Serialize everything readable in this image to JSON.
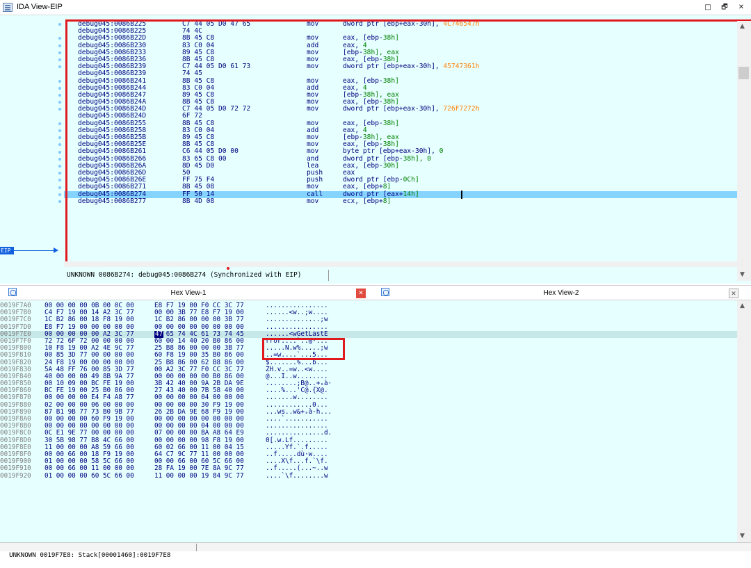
{
  "window": {
    "title": "IDA View-EIP",
    "controls": [
      "□",
      "🗗",
      "✕"
    ]
  },
  "ida": {
    "rows": [
      {
        "addr": "debug045:0086B225",
        "bytes": "C7 44 05 D0 47 65",
        "mnem": "mov",
        "ops": "dword ptr [ebp+eax-30h], ",
        "num": "",
        "imm": "4C746547h"
      },
      {
        "addr": "debug045:0086B225",
        "bytes": "74 4C",
        "mnem": "",
        "ops": "",
        "num": "",
        "imm": ""
      },
      {
        "addr": "debug045:0086B22D",
        "bytes": "8B 45 C8",
        "mnem": "mov",
        "ops": "eax, [ebp-",
        "num": "38h]",
        "imm": ""
      },
      {
        "addr": "debug045:0086B230",
        "bytes": "83 C0 04",
        "mnem": "add",
        "ops": "eax, ",
        "num": "4",
        "imm": ""
      },
      {
        "addr": "debug045:0086B233",
        "bytes": "89 45 C8",
        "mnem": "mov",
        "ops": "[ebp-",
        "num": "38h], eax",
        "imm": ""
      },
      {
        "addr": "debug045:0086B236",
        "bytes": "8B 45 C8",
        "mnem": "mov",
        "ops": "eax, [ebp-",
        "num": "38h]",
        "imm": ""
      },
      {
        "addr": "debug045:0086B239",
        "bytes": "C7 44 05 D0 61 73",
        "mnem": "mov",
        "ops": "dword ptr [ebp+eax-30h], ",
        "num": "",
        "imm": "45747361h"
      },
      {
        "addr": "debug045:0086B239",
        "bytes": "74 45",
        "mnem": "",
        "ops": "",
        "num": "",
        "imm": ""
      },
      {
        "addr": "debug045:0086B241",
        "bytes": "8B 45 C8",
        "mnem": "mov",
        "ops": "eax, [ebp-",
        "num": "38h]",
        "imm": ""
      },
      {
        "addr": "debug045:0086B244",
        "bytes": "83 C0 04",
        "mnem": "add",
        "ops": "eax, ",
        "num": "4",
        "imm": ""
      },
      {
        "addr": "debug045:0086B247",
        "bytes": "89 45 C8",
        "mnem": "mov",
        "ops": "[ebp-",
        "num": "38h], eax",
        "imm": ""
      },
      {
        "addr": "debug045:0086B24A",
        "bytes": "8B 45 C8",
        "mnem": "mov",
        "ops": "eax, [ebp-",
        "num": "38h]",
        "imm": ""
      },
      {
        "addr": "debug045:0086B24D",
        "bytes": "C7 44 05 D0 72 72",
        "mnem": "mov",
        "ops": "dword ptr [ebp+eax-30h], ",
        "num": "",
        "imm": "726F7272h"
      },
      {
        "addr": "debug045:0086B24D",
        "bytes": "6F 72",
        "mnem": "",
        "ops": "",
        "num": "",
        "imm": ""
      },
      {
        "addr": "debug045:0086B255",
        "bytes": "8B 45 C8",
        "mnem": "mov",
        "ops": "eax, [ebp-",
        "num": "38h]",
        "imm": ""
      },
      {
        "addr": "debug045:0086B258",
        "bytes": "83 C0 04",
        "mnem": "add",
        "ops": "eax, ",
        "num": "4",
        "imm": ""
      },
      {
        "addr": "debug045:0086B25B",
        "bytes": "89 45 C8",
        "mnem": "mov",
        "ops": "[ebp-",
        "num": "38h], eax",
        "imm": ""
      },
      {
        "addr": "debug045:0086B25E",
        "bytes": "8B 45 C8",
        "mnem": "mov",
        "ops": "eax, [ebp-",
        "num": "38h]",
        "imm": ""
      },
      {
        "addr": "debug045:0086B261",
        "bytes": "C6 44 05 D0 00",
        "mnem": "mov",
        "ops": "byte ptr [ebp+eax-30h], ",
        "num": "0",
        "imm": ""
      },
      {
        "addr": "debug045:0086B266",
        "bytes": "83 65 C8 00",
        "mnem": "and",
        "ops": "dword ptr [ebp-",
        "num": "38h], 0",
        "imm": ""
      },
      {
        "addr": "debug045:0086B26A",
        "bytes": "8D 45 D0",
        "mnem": "lea",
        "ops": "eax, [ebp-",
        "num": "30h]",
        "imm": ""
      },
      {
        "addr": "debug045:0086B26D",
        "bytes": "50",
        "mnem": "push",
        "ops": "eax",
        "num": "",
        "imm": ""
      },
      {
        "addr": "debug045:0086B26E",
        "bytes": "FF 75 F4",
        "mnem": "push",
        "ops": "dword ptr [ebp-",
        "num": "0Ch]",
        "imm": ""
      },
      {
        "addr": "debug045:0086B271",
        "bytes": "8B 45 08",
        "mnem": "mov",
        "ops": "eax, [ebp+",
        "num": "8]",
        "imm": ""
      },
      {
        "addr": "debug045:0086B274",
        "bytes": "FF 50 14",
        "mnem": "call",
        "ops": "dword ptr [eax+",
        "num": "14h]",
        "imm": "",
        "current": true
      },
      {
        "addr": "debug045:0086B277",
        "bytes": "8B 4D 08",
        "mnem": "mov",
        "ops": "ecx, [ebp+",
        "num": "8]",
        "imm": ""
      }
    ],
    "eip_label": "EIP",
    "status": "UNKNOWN 0086B274: debug045:0086B274 (Synchronized with EIP)"
  },
  "tabs": {
    "hex1": "Hex View-1",
    "hex2": "Hex View-2",
    "close": "✕"
  },
  "hex": {
    "rows": [
      {
        "addr": "0019F7A0",
        "b1": "00 00 00 00 0B 00 0C 00",
        "b2": "E8 F7 19 00 F0 CC 3C 77",
        "ascii": "................"
      },
      {
        "addr": "0019F7B0",
        "b1": "C4 F7 19 00 14 A2 3C 77",
        "b2": "00 00 3B 77 E8 F7 19 00",
        "ascii": "......<w..;w...."
      },
      {
        "addr": "0019F7C0",
        "b1": "1C B2 86 00 18 F8 19 00",
        "b2": "1C B2 86 00 00 00 3B 77",
        "ascii": "..............;w"
      },
      {
        "addr": "0019F7D0",
        "b1": "E8 F7 19 00 00 00 00 00",
        "b2": "00 00 00 00 00 00 00 00",
        "ascii": "................"
      },
      {
        "addr": "0019F7E0",
        "b1": "00 00 00 00 00 A2 3C 77",
        "b2": "   65 74 4C 61 73 74 45",
        "ascii": "......<wGetLastE",
        "sel": true
      },
      {
        "addr": "0019F7F0",
        "b1": "72 72 6F 72 00 00 00 00",
        "b2": "60 00 14 40 20 B0 86 00",
        "ascii": "rror....`..@·..."
      },
      {
        "addr": "0019F800",
        "b1": "10 F8 19 00 A2 4E 9C 77",
        "b2": "25 B8 86 00 00 00 3B 77",
        "ascii": ".....N.w%.....;w"
      },
      {
        "addr": "0019F810",
        "b1": "00 85 3D 77 00 00 00 00",
        "b2": "60 F8 19 00 35 B0 86 00",
        "ascii": "..=w....`...5..."
      },
      {
        "addr": "0019F820",
        "b1": "24 F8 19 00 00 00 00 00",
        "b2": "25 B8 86 00 62 B8 86 00",
        "ascii": "$.......%...b..."
      },
      {
        "addr": "0019F830",
        "b1": "5A 48 FF 76 00 85 3D 77",
        "b2": "00 A2 3C 77 F0 CC 3C 77",
        "ascii": "ZH.v..=w..<w...."
      },
      {
        "addr": "0019F840",
        "b1": "40 00 00 00 49 8B 9A 77",
        "b2": "00 00 00 00 00 B0 86 00",
        "ascii": "@...I..w........"
      },
      {
        "addr": "0019F850",
        "b1": "00 10 09 00 BC FE 19 00",
        "b2": "3B 42 40 00 9A 2B DA 9E",
        "ascii": "........;B@..+ₛà·"
      },
      {
        "addr": "0019F860",
        "b1": "BC FE 19 00 25 B0 86 00",
        "b2": "27 43 40 00 7B 58 40 00",
        "ascii": "....%...'C@.{X@."
      },
      {
        "addr": "0019F870",
        "b1": "00 00 00 00 E4 F4 A8 77",
        "b2": "00 00 00 00 04 00 00 00",
        "ascii": ".......w........"
      },
      {
        "addr": "0019F880",
        "b1": "02 00 00 00 06 00 00 00",
        "b2": "00 00 00 00 30 F9 19 00",
        "ascii": "............0..."
      },
      {
        "addr": "0019F890",
        "b1": "87 B1 9B 77 73 B0 9B 77",
        "b2": "26 2B DA 9E 68 F9 19 00",
        "ascii": "...ws..w&+ₛà·h..."
      },
      {
        "addr": "0019F8A0",
        "b1": "00 00 00 00 60 F9 19 00",
        "b2": "00 00 00 00 00 00 00 00",
        "ascii": "....`..........."
      },
      {
        "addr": "0019F8B0",
        "b1": "00 00 00 00 00 00 00 00",
        "b2": "00 00 00 00 04 00 00 00",
        "ascii": "................"
      },
      {
        "addr": "0019F8C0",
        "b1": "0C E1 9E 77 00 00 00 00",
        "b2": "07 00 00 00 BA A8 64 E9",
        "ascii": "...............d."
      },
      {
        "addr": "0019F8D0",
        "b1": "30 5B 98 77 B8 4C 66 00",
        "b2": "00 00 00 00 98 F8 19 00",
        "ascii": "0[.w.Lf........."
      },
      {
        "addr": "0019F8E0",
        "b1": "11 00 00 00 A8 59 66 00",
        "b2": "60 02 66 00 11 00 04 15",
        "ascii": ".....Yf.`.f....."
      },
      {
        "addr": "0019F8F0",
        "b1": "00 00 66 00 18 F9 19 00",
        "b2": "64 C7 9C 77 11 00 00 00",
        "ascii": "..f.....dù·w...."
      },
      {
        "addr": "0019F900",
        "b1": "01 00 00 00 58 5C 66 00",
        "b2": "00 00 66 00 60 5C 66 00",
        "ascii": "....X\\f...f.`\\f."
      },
      {
        "addr": "0019F910",
        "b1": "00 00 66 00 11 00 00 00",
        "b2": "28 FA 19 00 7E 8A 9C 77",
        "ascii": "..f.....(...~..w"
      },
      {
        "addr": "0019F920",
        "b1": "01 00 00 00 60 5C 66 00",
        "b2": "11 00 00 00 19 84 9C 77",
        "ascii": "....`\\f........w"
      }
    ],
    "cursor_byte": "47",
    "status": "UNKNOWN 0019F7E8: Stack[00001460]:0019F7E8"
  }
}
